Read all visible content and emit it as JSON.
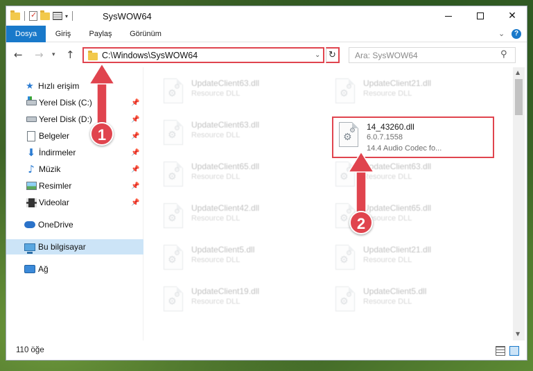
{
  "window": {
    "title": "SysWOW64"
  },
  "ribbon": {
    "tabs": [
      {
        "label": "Dosya"
      },
      {
        "label": "Giriş"
      },
      {
        "label": "Paylaş"
      },
      {
        "label": "Görünüm"
      }
    ],
    "help_label": "?"
  },
  "navbar": {
    "back_icon": "←",
    "forward_icon": "→",
    "up_icon": "↑",
    "address_path": "C:\\Windows\\SysWOW64",
    "search_placeholder": "Ara: SysWOW64"
  },
  "sidebar": {
    "items": [
      {
        "label": "Hızlı erişim",
        "icon": "star-icon"
      },
      {
        "label": "Yerel Disk (C:)",
        "icon": "drive-icon"
      },
      {
        "label": "Yerel Disk (D:)",
        "icon": "drive-icon"
      },
      {
        "label": "Belgeler",
        "icon": "document-icon"
      },
      {
        "label": "İndirmeler",
        "icon": "download-icon"
      },
      {
        "label": "Müzik",
        "icon": "music-icon"
      },
      {
        "label": "Resimler",
        "icon": "picture-icon"
      },
      {
        "label": "Videolar",
        "icon": "video-icon"
      },
      {
        "label": "OneDrive",
        "icon": "cloud-icon"
      },
      {
        "label": "Bu bilgisayar",
        "icon": "computer-icon"
      },
      {
        "label": "Ağ",
        "icon": "network-icon"
      }
    ]
  },
  "files": [
    {
      "name": "UpdateClient63.dll",
      "desc": "Resource DLL"
    },
    {
      "name": "UpdateClient21.dll",
      "desc": "Resource DLL"
    },
    {
      "name": "UpdateClient63.dll",
      "desc": "Resource DLL"
    },
    {
      "name": "14_43260.dll",
      "desc": "6.0.7.1558",
      "desc2": "14.4 Audio Codec fo..."
    },
    {
      "name": "UpdateClient65.dll",
      "desc": "Resource DLL"
    },
    {
      "name": "UpdateClient63.dll",
      "desc": "Resource DLL"
    },
    {
      "name": "UpdateClient42.dll",
      "desc": "Resource DLL"
    },
    {
      "name": "UpdateClient65.dll",
      "desc": "Resource DLL"
    },
    {
      "name": "UpdateClient5.dll",
      "desc": "Resource DLL"
    },
    {
      "name": "UpdateClient21.dll",
      "desc": "Resource DLL"
    },
    {
      "name": "UpdateClient19.dll",
      "desc": "Resource DLL"
    },
    {
      "name": "UpdateClient5.dll",
      "desc": "Resource DLL"
    }
  ],
  "status": {
    "item_count": "110 öğe"
  },
  "annotations": {
    "callout_1": "1",
    "callout_2": "2",
    "color": "#e0444e"
  }
}
